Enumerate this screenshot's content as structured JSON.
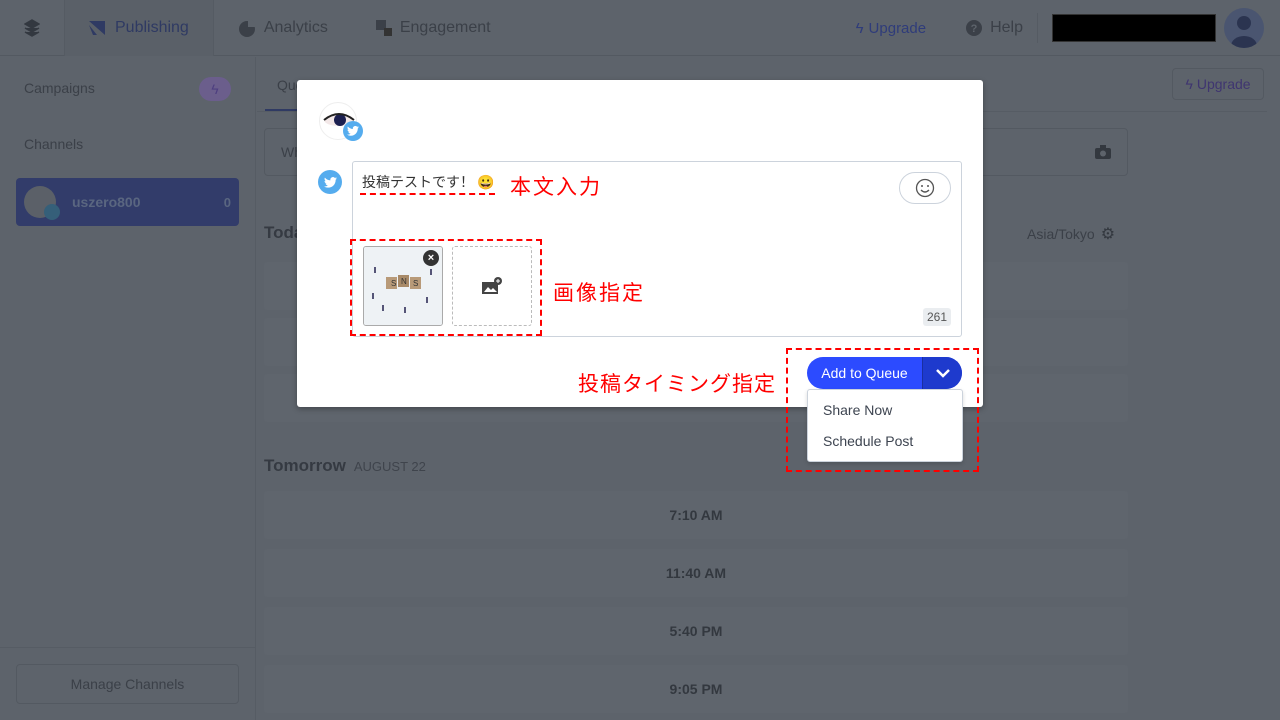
{
  "nav": {
    "items": [
      {
        "label": "Publishing",
        "icon": "publishing-icon",
        "active": true
      },
      {
        "label": "Analytics",
        "icon": "pie-chart-icon"
      },
      {
        "label": "Engagement",
        "icon": "engagement-icon"
      }
    ],
    "upgrade": "Upgrade",
    "help": "Help"
  },
  "sidebar": {
    "campaigns": "Campaigns",
    "channels": "Channels",
    "channel": {
      "name": "uszero800",
      "count": "0"
    },
    "manage": "Manage Channels"
  },
  "main": {
    "tab_queue": "Queue",
    "upgrade": "Upgrade",
    "composer_placeholder": "Wh",
    "today": "Toda",
    "timezone": "Asia/Tokyo",
    "tomorrow": "Tomorrow",
    "tomorrow_date": "AUGUST 22",
    "slots": [
      "7:10 AM",
      "11:40 AM",
      "5:40 PM",
      "9:05 PM"
    ]
  },
  "modal": {
    "text": "投稿テストです！",
    "emoji": "😀",
    "char_count": "261",
    "add_to_queue": "Add to Queue",
    "menu": [
      "Share Now",
      "Schedule Post"
    ]
  },
  "annotations": {
    "body": "本文入力",
    "image": "画像指定",
    "timing": "投稿タイミング指定"
  },
  "colors": {
    "accent": "#2c4bff",
    "twitter": "#55acee",
    "annotation": "#ff0000"
  }
}
